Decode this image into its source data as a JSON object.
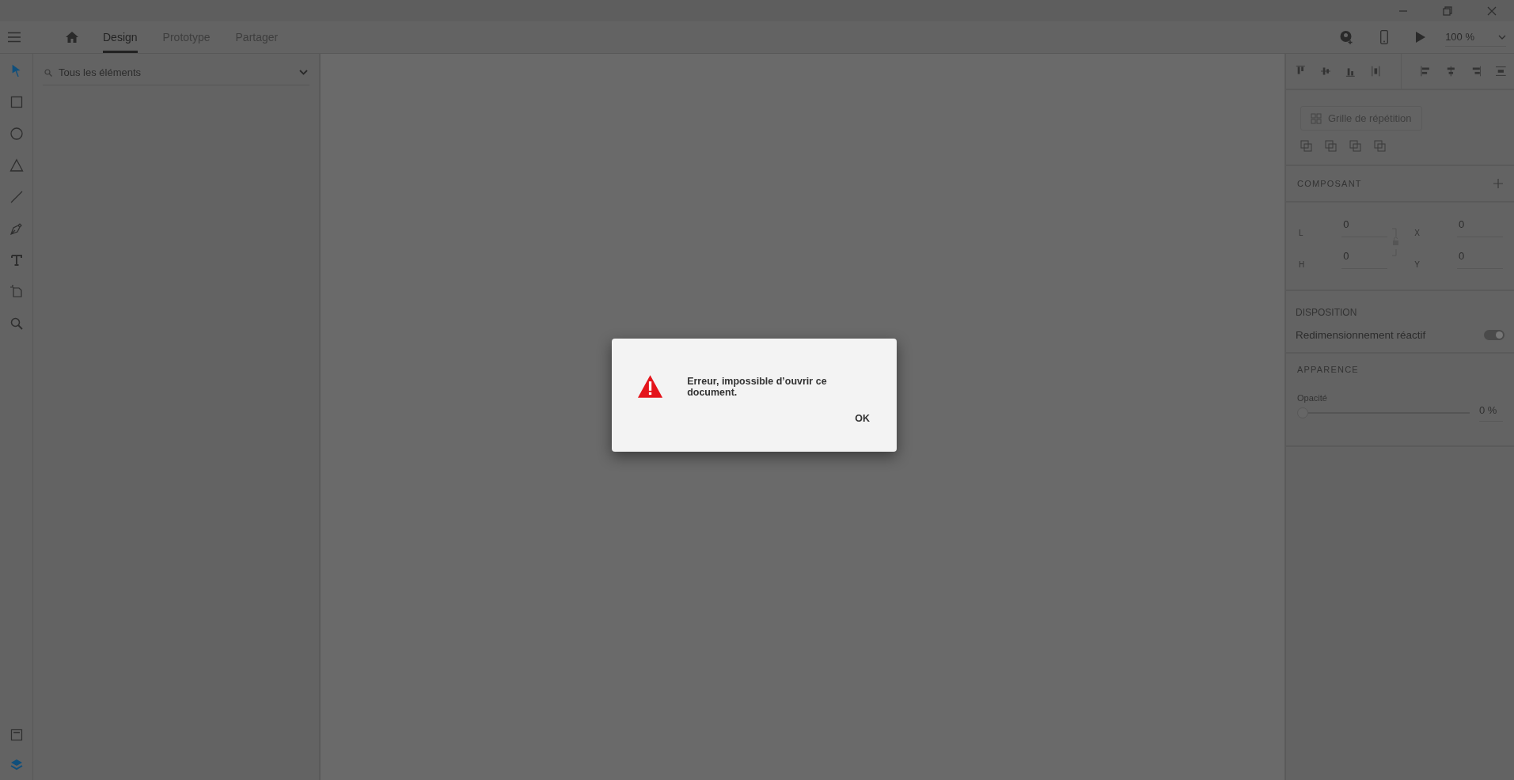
{
  "tabs": [
    {
      "label": "Design",
      "selected": true
    },
    {
      "label": "Prototype",
      "selected": false
    },
    {
      "label": "Partager",
      "selected": false
    }
  ],
  "zoom": {
    "value": "100 %"
  },
  "tools": [
    {
      "selected": true
    },
    {
      "selected": false
    },
    {
      "selected": false
    },
    {
      "selected": false
    },
    {
      "selected": false
    },
    {
      "selected": false
    },
    {
      "selected": false
    },
    {
      "selected": false
    },
    {
      "selected": false
    }
  ],
  "bottom_tools": [
    {
      "selected": false
    },
    {
      "selected": true
    }
  ],
  "layers": {
    "filter": "Tous les éléments"
  },
  "properties": {
    "repeat_grid_button": "Grille de répétition",
    "component_heading": "COMPOSANT",
    "fields": [
      {
        "label": "L",
        "value": "0"
      },
      {
        "label": "X",
        "value": "0"
      },
      {
        "label": "H",
        "value": "0"
      },
      {
        "label": "Y",
        "value": "0"
      }
    ],
    "layout_heading": "DISPOSITION",
    "responsive_resize": {
      "label": "Redimensionnement réactif",
      "on": true
    },
    "appearance_heading": "APPARENCE",
    "opacity": {
      "label": "Opacité",
      "level": 0,
      "reading": "0 %"
    }
  },
  "dialog": {
    "message": "Erreur, impossible d’ouvrir ce document.",
    "button": "OK"
  }
}
